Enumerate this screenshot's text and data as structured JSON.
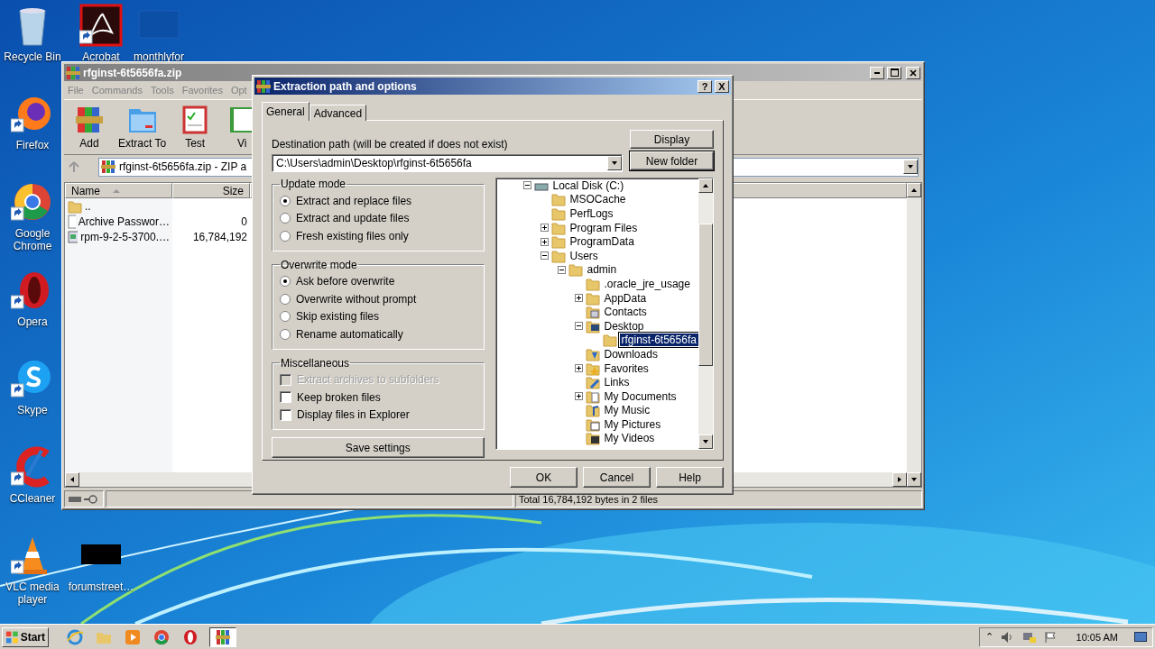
{
  "desktop": {
    "icons": [
      {
        "label": "Recycle Bin",
        "kind": "recycle"
      },
      {
        "label": "Acrobat",
        "kind": "acrobat"
      },
      {
        "label": "monthlyfor",
        "kind": "thumbnail"
      },
      {
        "label": "Firefox",
        "kind": "firefox"
      },
      {
        "label": "Google Chrome",
        "kind": "chrome"
      },
      {
        "label": "Opera",
        "kind": "opera"
      },
      {
        "label": "Skype",
        "kind": "skype"
      },
      {
        "label": "CCleaner",
        "kind": "ccleaner"
      },
      {
        "label": "VLC media player",
        "kind": "vlc"
      },
      {
        "label": "forumstreet…",
        "kind": "black"
      }
    ]
  },
  "archive_window": {
    "title": "rfginst-6t5656fa.zip",
    "menu": [
      "File",
      "Commands",
      "Tools",
      "Favorites",
      "Opt"
    ],
    "toolbar": [
      {
        "label": "Add",
        "kind": "add"
      },
      {
        "label": "Extract To",
        "kind": "extract"
      },
      {
        "label": "Test",
        "kind": "test"
      },
      {
        "label": "Vi",
        "kind": "view"
      }
    ],
    "address": "rfginst-6t5656fa.zip - ZIP a",
    "columns": [
      "Name",
      "Size"
    ],
    "rows": [
      {
        "name": "..",
        "kind": "up"
      },
      {
        "name": "Archive Passwor…",
        "size": "0",
        "kind": "text"
      },
      {
        "name": "rpm-9-2-5-3700.…",
        "size": "16,784,192",
        "kind": "exe"
      }
    ],
    "status": "Total 16,784,192 bytes in 2 files"
  },
  "dialog": {
    "title": "Extraction path and options",
    "help_button": "?",
    "close_button": "X",
    "tabs": [
      {
        "label": "General",
        "selected": true
      },
      {
        "label": "Advanced",
        "selected": false
      }
    ],
    "destination_label": "Destination path (will be created if does not exist)",
    "destination_value": "C:\\Users\\admin\\Desktop\\rfginst-6t5656fa",
    "side_buttons": [
      "Display",
      "New folder"
    ],
    "groups": [
      {
        "title": "Update mode",
        "options": [
          {
            "kind": "radio",
            "label": "Extract and replace files",
            "selected": true,
            "disabled": false
          },
          {
            "kind": "radio",
            "label": "Extract and update files",
            "selected": false,
            "disabled": false
          },
          {
            "kind": "radio",
            "label": "Fresh existing files only",
            "selected": false,
            "disabled": false
          }
        ]
      },
      {
        "title": "Overwrite mode",
        "options": [
          {
            "kind": "radio",
            "label": "Ask before overwrite",
            "selected": true,
            "disabled": false
          },
          {
            "kind": "radio",
            "label": "Overwrite without prompt",
            "selected": false,
            "disabled": false
          },
          {
            "kind": "radio",
            "label": "Skip existing files",
            "selected": false,
            "disabled": false
          },
          {
            "kind": "radio",
            "label": "Rename automatically",
            "selected": false,
            "disabled": false
          }
        ]
      },
      {
        "title": "Miscellaneous",
        "options": [
          {
            "kind": "checkbox",
            "label": "Extract archives to subfolders",
            "checked": false,
            "disabled": true
          },
          {
            "kind": "checkbox",
            "label": "Keep broken files",
            "checked": false,
            "disabled": false
          },
          {
            "kind": "checkbox",
            "label": "Display files in Explorer",
            "checked": false,
            "disabled": false
          }
        ]
      }
    ],
    "save_button": "Save settings",
    "tree": [
      {
        "label": "Local Disk (C:)",
        "kind": "drive",
        "expanded": true,
        "selected": false,
        "children": [
          {
            "label": "MSOCache",
            "kind": "folder",
            "selected": false
          },
          {
            "label": "PerfLogs",
            "kind": "folder",
            "selected": false
          },
          {
            "label": "Program Files",
            "kind": "folder",
            "expanded": false,
            "selected": false
          },
          {
            "label": "ProgramData",
            "kind": "folder",
            "expanded": false,
            "selected": false
          },
          {
            "label": "Users",
            "kind": "folder",
            "expanded": true,
            "selected": false,
            "children": [
              {
                "label": "admin",
                "kind": "folder",
                "expanded": true,
                "selected": false,
                "children": [
                  {
                    "label": ".oracle_jre_usage",
                    "kind": "folder",
                    "selected": false
                  },
                  {
                    "label": "AppData",
                    "kind": "folder",
                    "expanded": false,
                    "selected": false
                  },
                  {
                    "label": "Contacts",
                    "kind": "contacts",
                    "selected": false
                  },
                  {
                    "label": "Desktop",
                    "kind": "desktop",
                    "expanded": true,
                    "selected": false,
                    "children": [
                      {
                        "label": "rfginst-6t5656fa",
                        "kind": "folder",
                        "selected": true
                      }
                    ]
                  },
                  {
                    "label": "Downloads",
                    "kind": "downloads",
                    "selected": false
                  },
                  {
                    "label": "Favorites",
                    "kind": "favorites",
                    "expanded": false,
                    "selected": false
                  },
                  {
                    "label": "Links",
                    "kind": "links",
                    "selected": false
                  },
                  {
                    "label": "My Documents",
                    "kind": "documents",
                    "expanded": false,
                    "selected": false
                  },
                  {
                    "label": "My Music",
                    "kind": "music",
                    "selected": false
                  },
                  {
                    "label": "My Pictures",
                    "kind": "pictures",
                    "selected": false
                  },
                  {
                    "label": "My Videos",
                    "kind": "videos",
                    "selected": false
                  }
                ]
              }
            ]
          }
        ]
      }
    ],
    "buttons": [
      "OK",
      "Cancel",
      "Help"
    ]
  },
  "taskbar": {
    "start": "Start",
    "apps": [
      {
        "kind": "ie",
        "selected": false
      },
      {
        "kind": "explorer",
        "selected": false
      },
      {
        "kind": "media",
        "selected": false
      },
      {
        "kind": "chrome",
        "selected": false
      },
      {
        "kind": "opera",
        "selected": false
      },
      {
        "kind": "winrar",
        "selected": true
      }
    ],
    "tray_expand": "⌃",
    "clock": "10:05 AM"
  }
}
